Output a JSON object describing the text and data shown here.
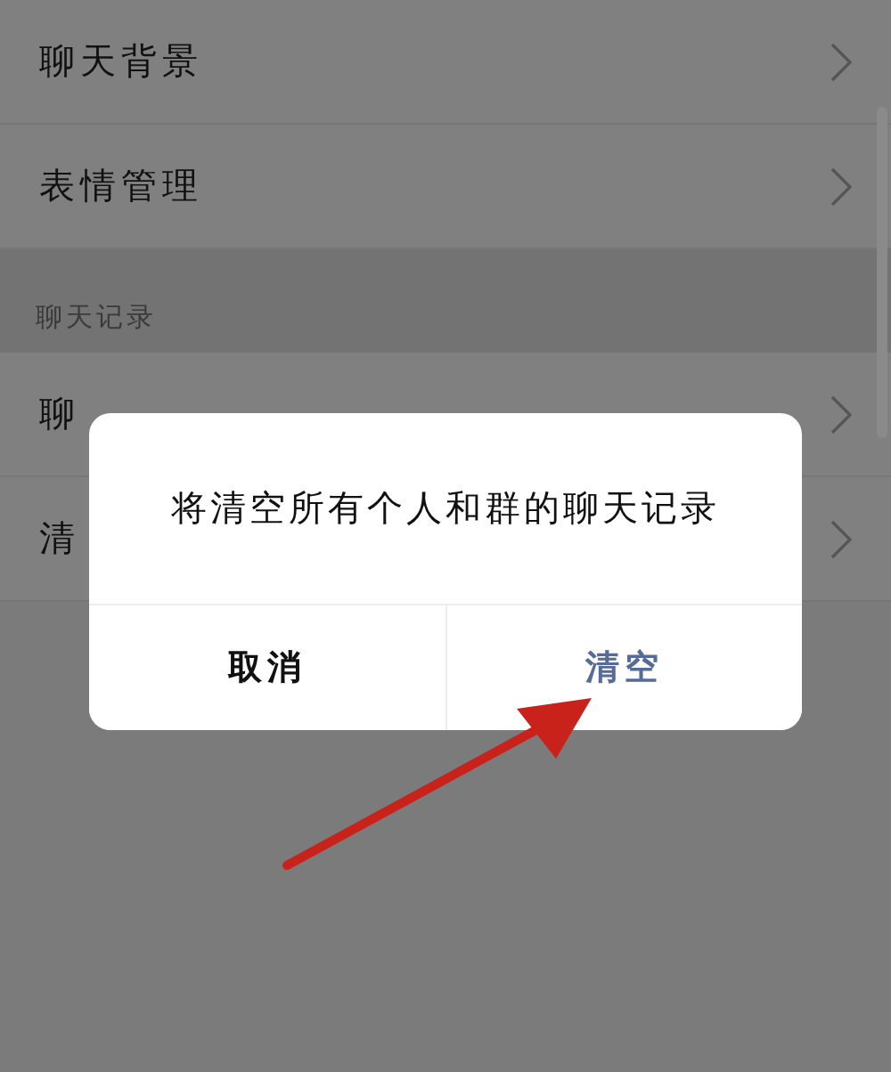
{
  "settings": [
    {
      "kind": "row",
      "label": "聊天背景"
    },
    {
      "kind": "row",
      "label": "表情管理"
    },
    {
      "kind": "section",
      "label": "聊天记录"
    },
    {
      "kind": "row",
      "label": "聊"
    },
    {
      "kind": "row",
      "label": "清"
    }
  ],
  "dialog": {
    "message": "将清空所有个人和群的聊天记录",
    "buttons": [
      {
        "label": "取消",
        "primary": false
      },
      {
        "label": "清空",
        "primary": true
      }
    ]
  },
  "annotation": {
    "kind": "arrow"
  }
}
